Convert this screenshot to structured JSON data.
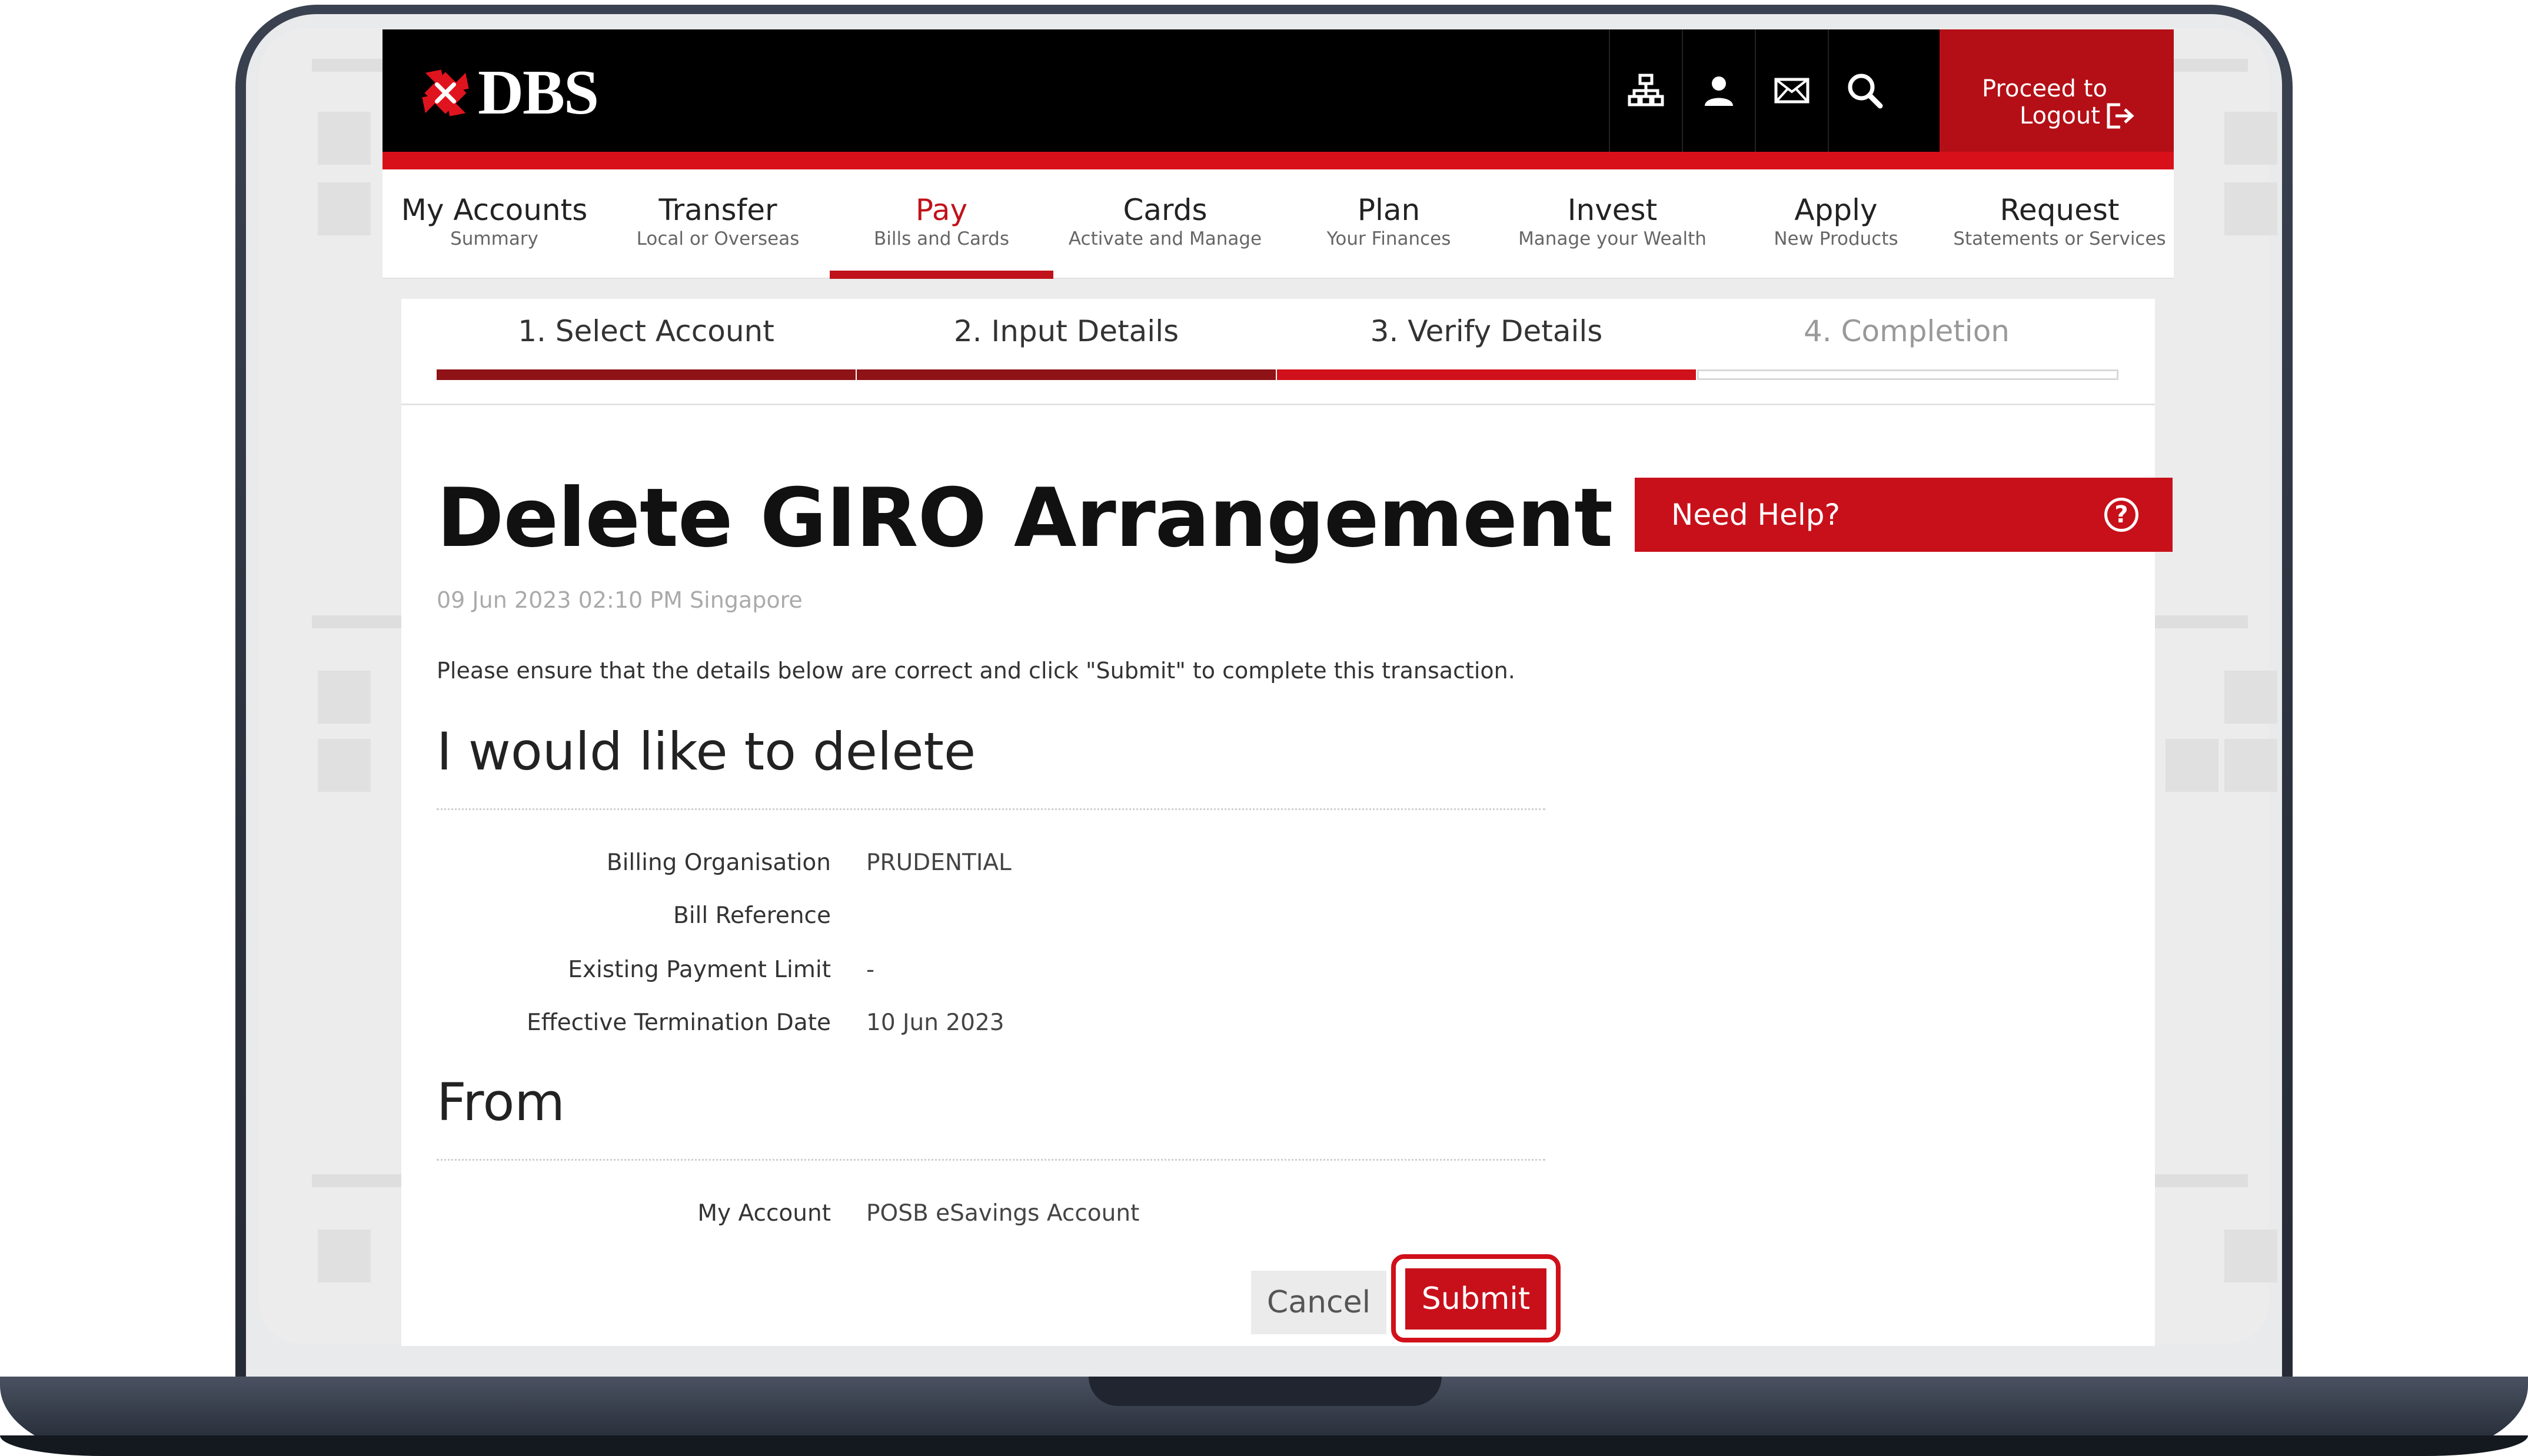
{
  "brand": {
    "name": "DBS",
    "accent": "#d8101a",
    "dark_red": "#b40f17"
  },
  "header": {
    "icons": [
      "sitemap-icon",
      "user-icon",
      "mail-icon",
      "search-icon"
    ],
    "logout_line1": "Proceed to",
    "logout_line2": "Logout"
  },
  "nav": [
    {
      "title": "My Accounts",
      "sub": "Summary"
    },
    {
      "title": "Transfer",
      "sub": "Local or Overseas"
    },
    {
      "title": "Pay",
      "sub": "Bills and Cards",
      "active": true
    },
    {
      "title": "Cards",
      "sub": "Activate and Manage"
    },
    {
      "title": "Plan",
      "sub": "Your Finances"
    },
    {
      "title": "Invest",
      "sub": "Manage your Wealth"
    },
    {
      "title": "Apply",
      "sub": "New Products"
    },
    {
      "title": "Request",
      "sub": "Statements or Services"
    }
  ],
  "steps": [
    {
      "label": "1. Select Account",
      "state": "done"
    },
    {
      "label": "2. Input Details",
      "state": "done"
    },
    {
      "label": "3. Verify Details",
      "state": "current"
    },
    {
      "label": "4. Completion",
      "state": "todo"
    }
  ],
  "page": {
    "title": "Delete GIRO Arrangement",
    "timestamp": "09 Jun 2023 02:10 PM Singapore",
    "instruction": "Please ensure that the details below are correct and click \"Submit\" to complete this transaction."
  },
  "section_delete": {
    "heading": "I would like to delete",
    "rows": [
      {
        "label": "Billing Organisation",
        "value": "PRUDENTIAL"
      },
      {
        "label": "Bill Reference",
        "value": ""
      },
      {
        "label": "Existing Payment Limit",
        "value": "-"
      },
      {
        "label": "Effective Termination Date",
        "value": "10 Jun 2023"
      }
    ]
  },
  "section_from": {
    "heading": "From",
    "rows": [
      {
        "label": "My Account",
        "value": "POSB eSavings Account"
      }
    ]
  },
  "help": {
    "label": "Need Help?",
    "icon": "question-circle-icon"
  },
  "actions": {
    "cancel": "Cancel",
    "submit": "Submit"
  }
}
